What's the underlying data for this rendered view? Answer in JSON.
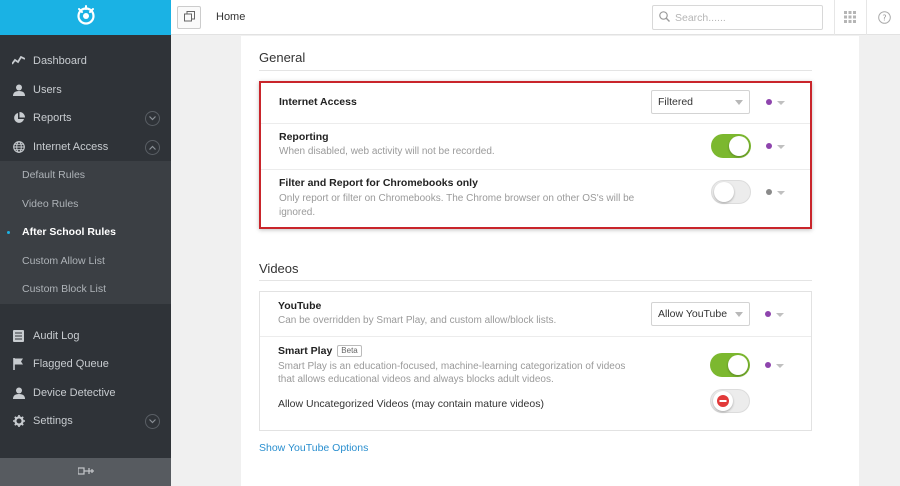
{
  "sidebar": {
    "logo": "webfilter-logo-icon",
    "items": [
      {
        "label": "Dashboard",
        "icon": "dashboard-icon"
      },
      {
        "label": "Users",
        "icon": "user-icon"
      },
      {
        "label": "Reports",
        "icon": "pie-chart-icon"
      },
      {
        "label": "Internet Access",
        "icon": "globe-icon"
      }
    ],
    "subitems": [
      {
        "label": "Default Rules"
      },
      {
        "label": "Video Rules"
      },
      {
        "label": "After School Rules",
        "active": true
      },
      {
        "label": "Custom Allow List"
      },
      {
        "label": "Custom Block List"
      }
    ],
    "items2": [
      {
        "label": "Audit Log",
        "icon": "list-icon"
      },
      {
        "label": "Flagged Queue",
        "icon": "flag-icon"
      },
      {
        "label": "Device Detective",
        "icon": "user-icon"
      },
      {
        "label": "Settings",
        "icon": "gear-icon"
      }
    ],
    "footer_icon": "collapse-icon"
  },
  "topbar": {
    "breadcrumb": "Home",
    "search_placeholder": "Search......",
    "grid_icon": "apps-grid-icon",
    "help_icon": "help-icon"
  },
  "general": {
    "title": "General",
    "internet_access": {
      "label": "Internet Access",
      "value": "Filtered"
    },
    "reporting": {
      "label": "Reporting",
      "desc": "When disabled, web activity will not be recorded.",
      "enabled": true
    },
    "chromebooks": {
      "label": "Filter and Report for Chromebooks only",
      "desc_line1": "Only report or filter on Chromebooks. The Chrome browser on other OS's will be",
      "desc_line2": "ignored.",
      "enabled": false
    }
  },
  "videos": {
    "title": "Videos",
    "youtube": {
      "label": "YouTube",
      "desc": "Can be overridden by Smart Play, and custom allow/block lists.",
      "value": "Allow YouTube"
    },
    "smart_play": {
      "label": "Smart Play",
      "badge": "Beta",
      "desc_line1": "Smart Play is an education-focused, machine-learning categorization of videos",
      "desc_line2": "that allows educational videos and always blocks adult videos.",
      "enabled": true
    },
    "uncategorized": {
      "label": "Allow Uncategorized Videos (may contain mature videos)",
      "enabled": false
    },
    "options_link": "Show YouTube Options"
  },
  "colors": {
    "accent": "#1ab2e4",
    "toggle_on": "#7cb82f",
    "dot_purple": "#8e44ad",
    "dot_gray": "#8a8a8a",
    "highlight_red": "#c9252b",
    "link": "#2a8fcf"
  }
}
